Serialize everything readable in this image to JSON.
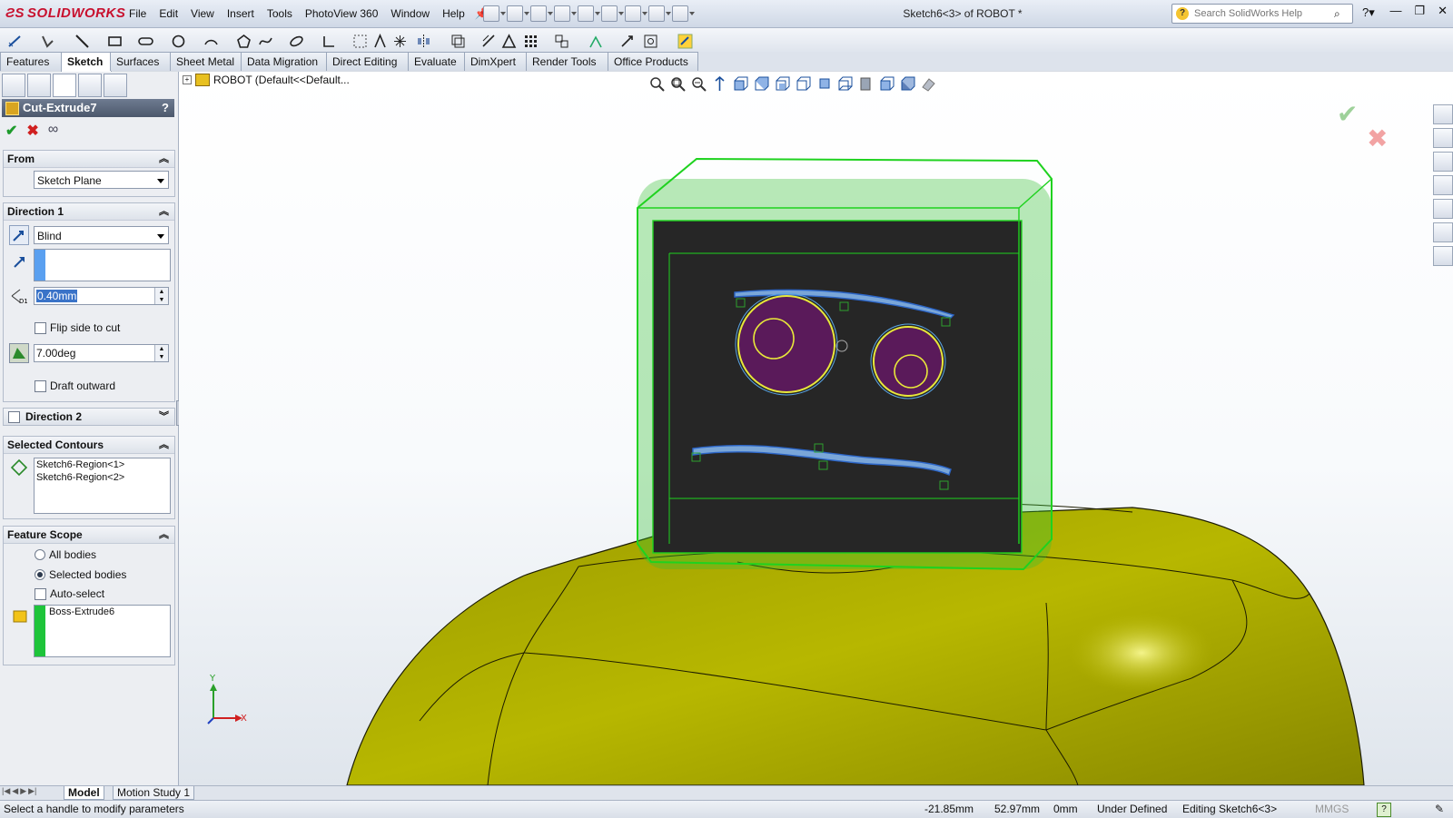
{
  "app": {
    "brand": "SOLIDWORKS",
    "doc_title": "Sketch6<3> of ROBOT *"
  },
  "menu": [
    "File",
    "Edit",
    "View",
    "Insert",
    "Tools",
    "PhotoView 360",
    "Window",
    "Help"
  ],
  "search": {
    "placeholder": "Search SolidWorks Help"
  },
  "tabs": [
    "Features",
    "Sketch",
    "Surfaces",
    "Sheet Metal",
    "Data Migration",
    "Direct Editing",
    "Evaluate",
    "DimXpert",
    "Render Tools",
    "Office Products"
  ],
  "active_tab": "Sketch",
  "property_manager": {
    "title": "Cut-Extrude7",
    "help": "?",
    "from": {
      "label": "From",
      "value": "Sketch Plane"
    },
    "direction1": {
      "label": "Direction 1",
      "end_condition": "Blind",
      "depth": "0.40mm",
      "flip_label": "Flip side to cut",
      "draft": "7.00deg",
      "draft_outward": "Draft outward"
    },
    "direction2": {
      "label": "Direction 2"
    },
    "selected_contours": {
      "label": "Selected Contours",
      "items": [
        "Sketch6-Region<1>",
        "Sketch6-Region<2>"
      ]
    },
    "feature_scope": {
      "label": "Feature Scope",
      "all_bodies": "All bodies",
      "selected_bodies": "Selected bodies",
      "auto_select": "Auto-select",
      "bodies": [
        "Boss-Extrude6"
      ]
    }
  },
  "tree": {
    "root": "ROBOT  (Default<<Default..."
  },
  "triad": {
    "x": "X",
    "y": "Y"
  },
  "bottom_tabs": [
    "Model",
    "Motion Study 1"
  ],
  "status": {
    "message": "Select a handle to modify parameters",
    "x": "-21.85mm",
    "y": "52.97mm",
    "z": "0mm",
    "state": "Under Defined",
    "editing": "Editing Sketch6<3>",
    "units": "MMGS"
  },
  "colors": {
    "body": "#b8b800",
    "head_outline": "#22dd22",
    "face": "#222222",
    "eye": "#5a1a5a"
  }
}
